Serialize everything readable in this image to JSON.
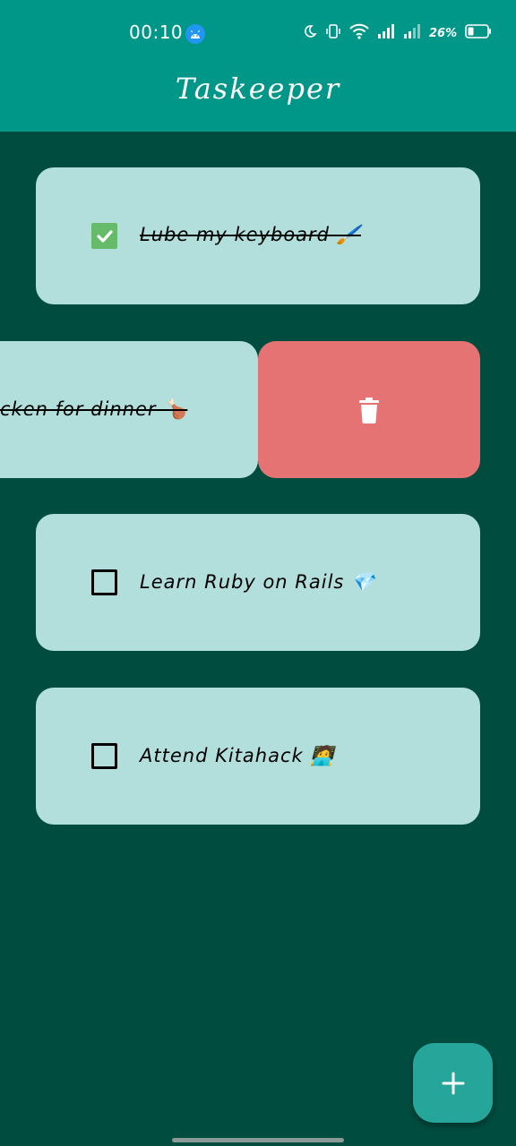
{
  "status_bar": {
    "time": "00:10",
    "battery": "26%"
  },
  "app": {
    "title": "Taskeeper"
  },
  "tasks": [
    {
      "label": "Lube my keyboard 🖌️",
      "done": true
    },
    {
      "label": "cken for dinner 🍗",
      "done": true,
      "swiped": true
    },
    {
      "label": "Learn Ruby on Rails 💎",
      "done": false
    },
    {
      "label": "Attend Kitahack 🧑‍💻",
      "done": false
    }
  ],
  "colors": {
    "header": "#009688",
    "background": "#004D40",
    "card": "#B2DFDB",
    "delete": "#E57373",
    "check": "#66BB6A",
    "fab": "#26A69A"
  },
  "icons": {
    "delete": "trash-icon",
    "fab": "plus-icon"
  }
}
